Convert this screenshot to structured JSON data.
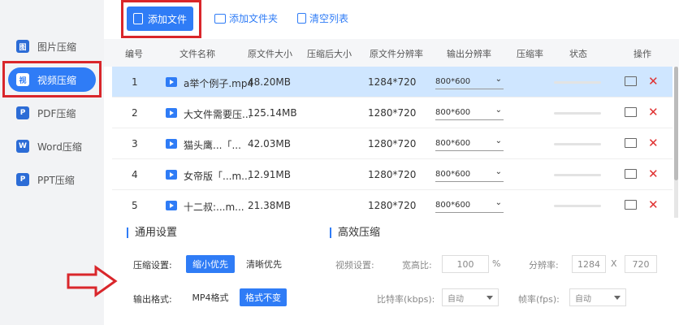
{
  "sidebar": {
    "items": [
      {
        "label": "图片压缩",
        "icon": "image-icon",
        "glyph": "图"
      },
      {
        "label": "视频压缩",
        "icon": "video-icon",
        "glyph": "视"
      },
      {
        "label": "PDF压缩",
        "icon": "pdf-icon",
        "glyph": "P"
      },
      {
        "label": "Word压缩",
        "icon": "word-icon",
        "glyph": "W"
      },
      {
        "label": "PPT压缩",
        "icon": "ppt-icon",
        "glyph": "P"
      }
    ],
    "active_index": 1
  },
  "toolbar": {
    "add_file": "添加文件",
    "add_folder": "添加文件夹",
    "clear_list": "清空列表"
  },
  "table": {
    "headers": [
      "编号",
      "文件名称",
      "原文件大小",
      "压缩后大小",
      "原文件分辨率",
      "输出分辨率",
      "压缩率",
      "状态",
      "操作"
    ],
    "rows": [
      {
        "num": "1",
        "name": "a举个例子.mp4",
        "size": "48.20MB",
        "compressed": "",
        "res": "1284*720",
        "out": "800*600",
        "selected": true
      },
      {
        "num": "2",
        "name": "大文件需要压...",
        "size": "125.14MB",
        "compressed": "",
        "res": "1280*720",
        "out": "800*600",
        "selected": false
      },
      {
        "num": "3",
        "name": "猫头鹰...「...",
        "size": "42.03MB",
        "compressed": "",
        "res": "1280*720",
        "out": "800*600",
        "selected": false
      },
      {
        "num": "4",
        "name": "女帝版「...m...",
        "size": "12.91MB",
        "compressed": "",
        "res": "1280*720",
        "out": "800*600",
        "selected": false
      },
      {
        "num": "5",
        "name": "十二叔:...m...",
        "size": "21.38MB",
        "compressed": "",
        "res": "1280*720",
        "out": "800*600",
        "selected": false
      }
    ]
  },
  "settings": {
    "general_title": "通用设置",
    "efficient_title": "高效压缩",
    "compress_label": "压缩设置:",
    "opt_small": "缩小优先",
    "opt_clear": "清晰优先",
    "format_label": "输出格式:",
    "fmt_mp4": "MP4格式",
    "fmt_keep": "格式不变",
    "video_settings_label": "视频设置:",
    "aspect_label": "宽高比:",
    "aspect_value": "100",
    "percent": "%",
    "resolution_label": "分辨率:",
    "res_w": "1284",
    "res_x": "X",
    "res_h": "720",
    "bitrate_label": "比特率(kbps):",
    "bitrate_value": "自动",
    "fps_label": "帧率(fps):",
    "fps_value": "自动"
  },
  "colors": {
    "accent": "#2f7cf6",
    "highlight": "#d9262b",
    "selected_row": "#cfe6ff"
  }
}
